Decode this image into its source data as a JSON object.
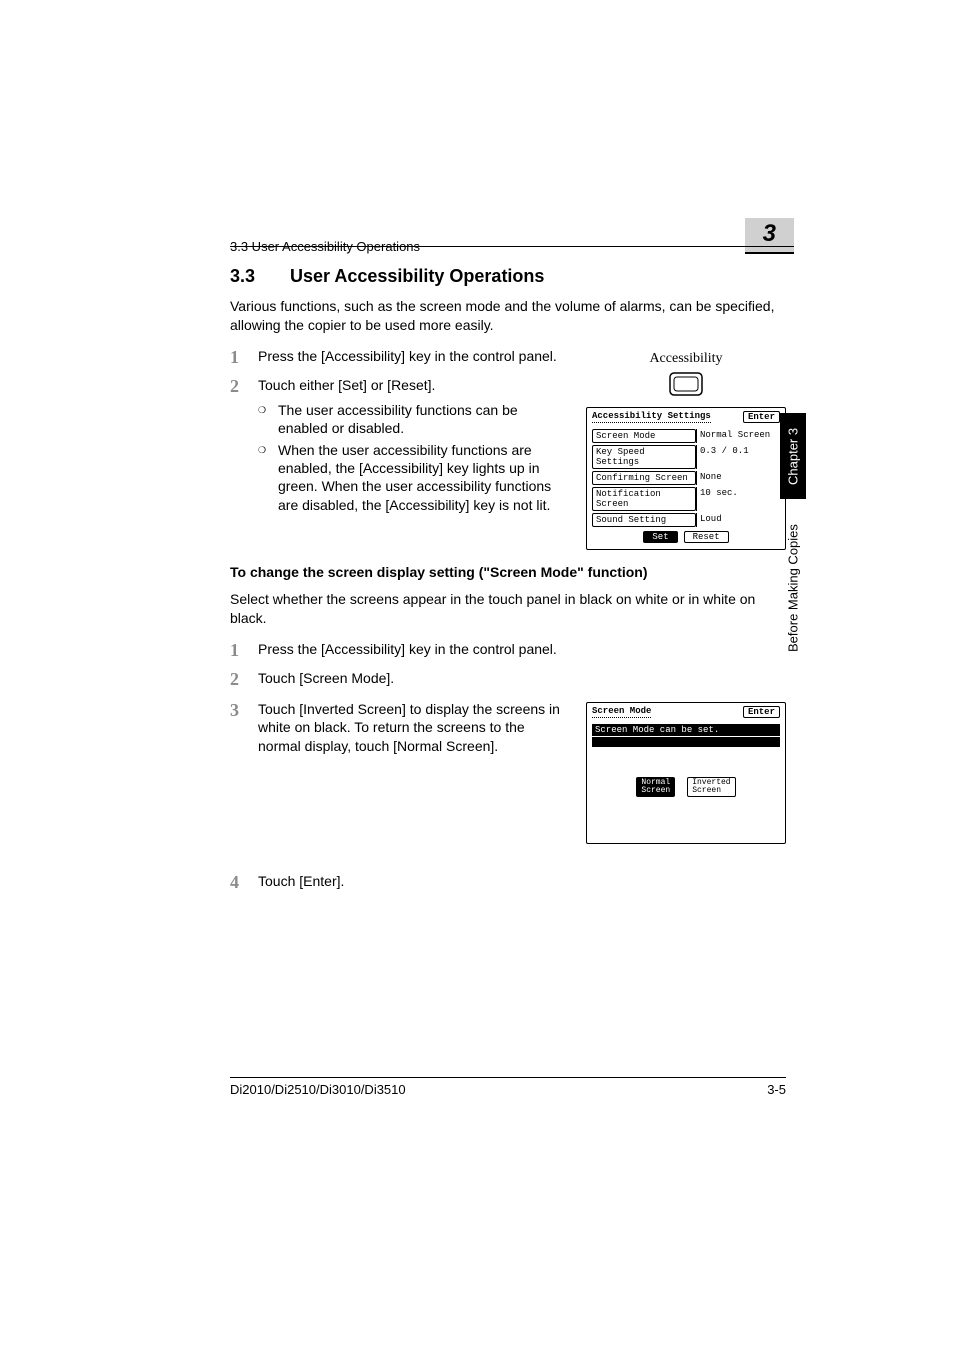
{
  "running_header": {
    "left": "3.3 User Accessibility Operations",
    "chapter_badge": "3"
  },
  "heading": {
    "num": "3.3",
    "title": "User Accessibility Operations"
  },
  "intro": "Various functions, such as the screen mode and the volume of alarms, can be specified, allowing the copier to be used more easily.",
  "steps_a": [
    {
      "n": "1",
      "text": "Press the [Accessibility] key in the control panel."
    },
    {
      "n": "2",
      "text": "Touch either [Set] or [Reset].",
      "subs": [
        "The user accessibility functions can be enabled or disabled.",
        "When the user accessibility functions are enabled, the [Accessibility] key lights up in green. When the user accessibility functions are disabled, the [Accessibility] key is not lit."
      ]
    }
  ],
  "key_diagram": {
    "label": "Accessibility"
  },
  "settings_panel": {
    "title": "Accessibility Settings",
    "enter": "Enter",
    "rows": [
      {
        "k": "Screen Mode",
        "v": "Normal Screen",
        "selected": true
      },
      {
        "k": "Key Speed Settings",
        "v": "0.3 / 0.1"
      },
      {
        "k": "Confirming Screen",
        "v": "None",
        "selected": true
      },
      {
        "k": "Notification Screen",
        "v": "10 sec."
      },
      {
        "k": "Sound Setting",
        "v": "Loud"
      }
    ],
    "set": "Set",
    "reset": "Reset"
  },
  "subhead": "To change the screen display setting (\"Screen Mode\" function)",
  "sub_intro": "Select whether the screens appear in the touch panel in black on white or in white on black.",
  "steps_b": [
    {
      "n": "1",
      "text": "Press the [Accessibility] key in the control panel."
    },
    {
      "n": "2",
      "text": "Touch [Screen Mode]."
    },
    {
      "n": "3",
      "text": "Touch [Inverted Screen] to display the screens in white on black. To return the screens to the normal display, touch [Normal Screen]."
    },
    {
      "n": "4",
      "text": "Touch [Enter]."
    }
  ],
  "mode_panel": {
    "title": "Screen Mode",
    "enter": "Enter",
    "message": "Screen Mode can be set.",
    "normal_l1": "Normal",
    "normal_l2": "Screen",
    "inverted_l1": "Inverted",
    "inverted_l2": "Screen"
  },
  "side_tabs": {
    "chapter": "Chapter 3",
    "section": "Before Making Copies"
  },
  "footer": {
    "left": "Di2010/Di2510/Di3010/Di3510",
    "right": "3-5"
  }
}
